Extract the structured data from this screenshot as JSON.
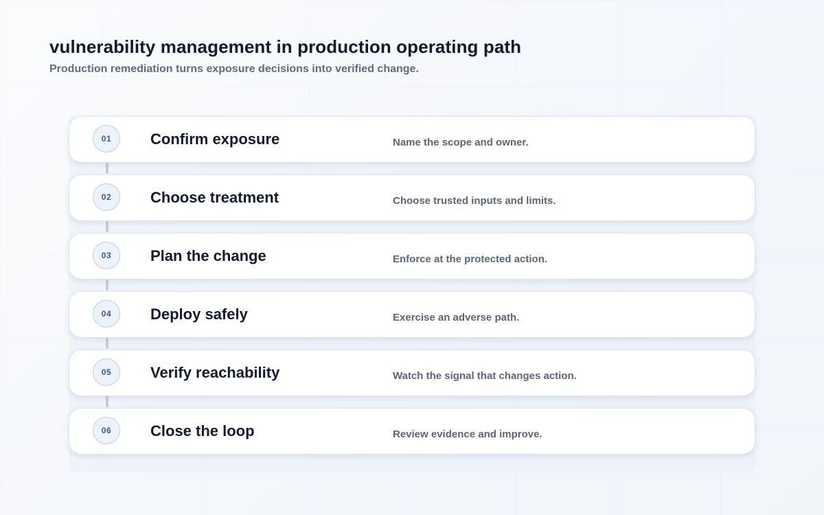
{
  "header": {
    "title": "vulnerability management in production operating path",
    "subtitle": "Production remediation turns exposure decisions into verified change."
  },
  "steps": [
    {
      "number": "01",
      "title": "Confirm exposure",
      "description": "Name the scope and owner."
    },
    {
      "number": "02",
      "title": "Choose treatment",
      "description": "Choose trusted inputs and limits."
    },
    {
      "number": "03",
      "title": "Plan the change",
      "description": "Enforce at the protected action."
    },
    {
      "number": "04",
      "title": "Deploy safely",
      "description": "Exercise an adverse path."
    },
    {
      "number": "05",
      "title": "Verify reachability",
      "description": "Watch the signal that changes action."
    },
    {
      "number": "06",
      "title": "Close the loop",
      "description": "Review evidence and improve."
    }
  ]
}
